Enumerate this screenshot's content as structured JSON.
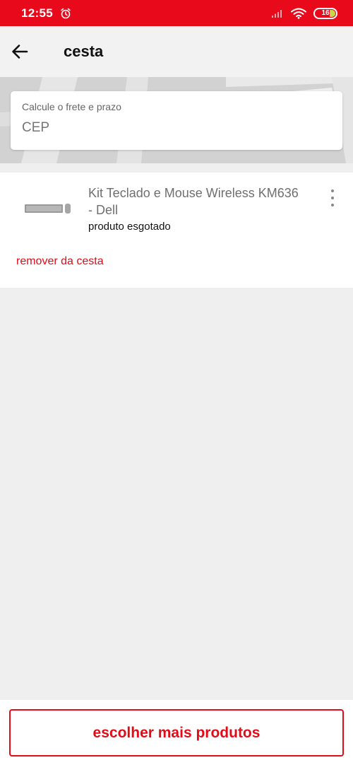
{
  "status_bar": {
    "time": "12:55",
    "battery": "16",
    "icons": [
      "alarm-icon",
      "signal-icon",
      "wifi-icon",
      "battery-icon"
    ]
  },
  "app_bar": {
    "title": "cesta",
    "back_icon": "arrow-left-icon"
  },
  "shipping": {
    "label": "Calcule o frete e prazo",
    "placeholder": "CEP"
  },
  "cart": {
    "items": [
      {
        "name": "Kit Teclado e Mouse Wireless KM636 - Dell",
        "status": "produto esgotado",
        "remove_label": "remover da cesta",
        "menu_icon": "more-vertical-icon"
      }
    ]
  },
  "footer": {
    "more_products_label": "escolher mais produtos"
  },
  "colors": {
    "brand_red": "#e20b18",
    "status_bar": "#e8091b",
    "background": "#efefef"
  }
}
